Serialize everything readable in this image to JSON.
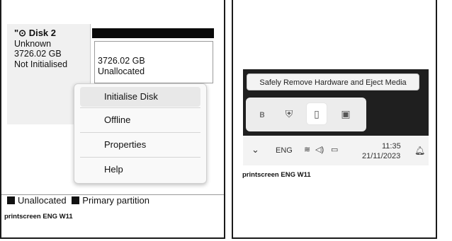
{
  "left_panel": {
    "disk": {
      "name": "Disk 2",
      "type": "Unknown",
      "size": "3726.02 GB",
      "status": "Not Initialised",
      "partition_size": "3726.02 GB",
      "partition_status": "Unallocated"
    },
    "context_menu": {
      "items": [
        {
          "label": "Initialise Disk"
        },
        {
          "label": "Offline"
        },
        {
          "label": "Properties"
        },
        {
          "label": "Help"
        }
      ]
    },
    "legend": {
      "unallocated": "Unallocated",
      "primary": "Primary partition"
    },
    "caption": "printscreen ENG W11"
  },
  "right_panel": {
    "tooltip": "Safely Remove Hardware and Eject Media",
    "tray_icons": [
      "bluetooth-icon",
      "security-icon",
      "usb-drive-icon",
      "teams-icon"
    ],
    "taskbar": {
      "language": "ENG",
      "time": "11:35",
      "date": "21/11/2023"
    },
    "caption": "printscreen ENG W11"
  }
}
